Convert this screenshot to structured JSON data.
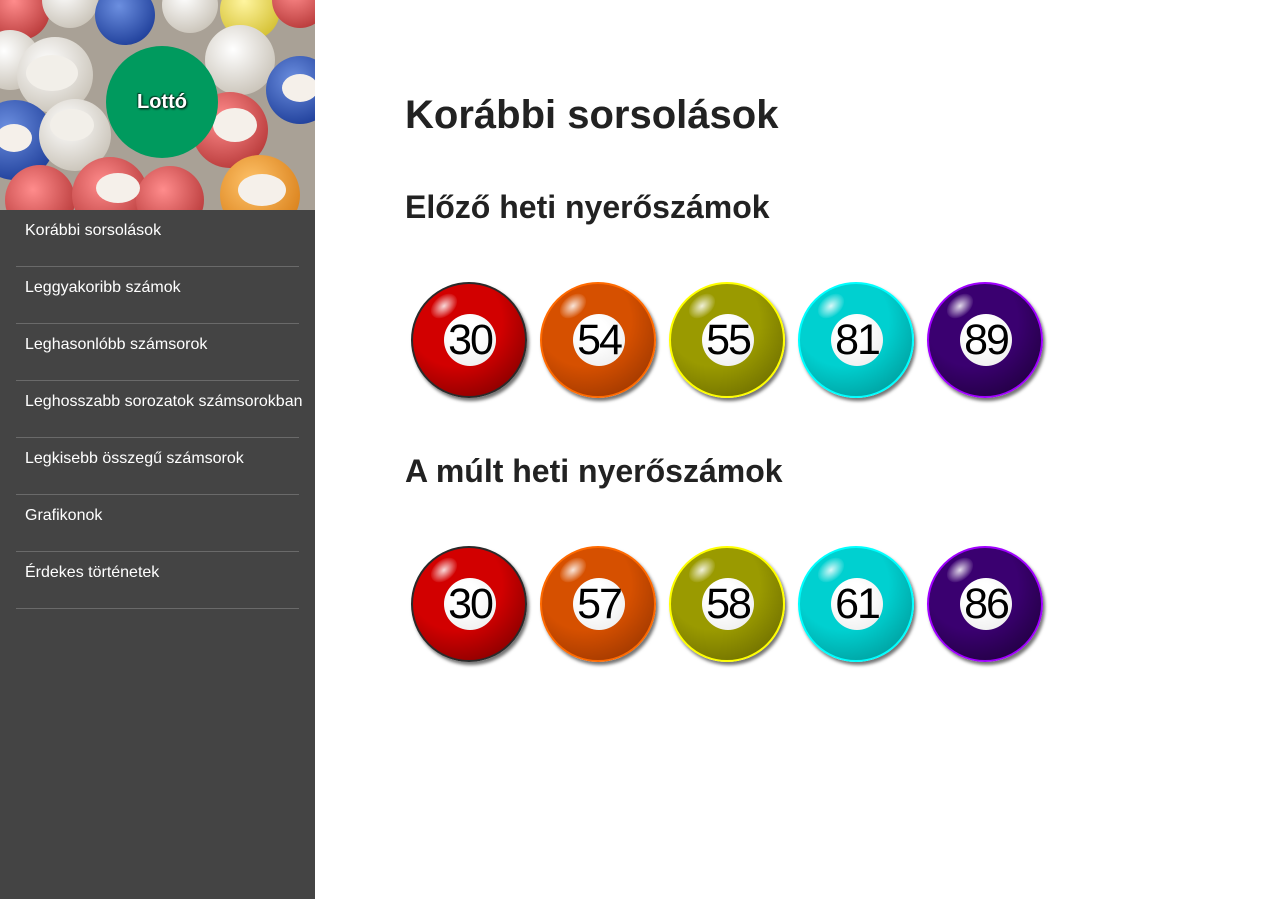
{
  "sidebar": {
    "logo_text": "Lottó",
    "logo_color": "#009a5e",
    "header_image_icon": "lottery-balls-image",
    "items": [
      {
        "label": "Korábbi sorsolások"
      },
      {
        "label": "Leggyakoribb számok"
      },
      {
        "label": "Leghasonlóbb számsorok"
      },
      {
        "label": "Leghosszabb sorozatok számsorokban"
      },
      {
        "label": "Legkisebb összegű számsorok"
      },
      {
        "label": "Grafikonok"
      },
      {
        "label": "Érdekes történetek"
      }
    ]
  },
  "main": {
    "title": "Korábbi sorsolások",
    "sections": [
      {
        "heading": "Előző heti nyerőszámok",
        "balls": [
          {
            "number": "30",
            "color": "#d20000",
            "dark": "#6a0000",
            "rim": "#2a2a2a"
          },
          {
            "number": "54",
            "color": "#d65000",
            "dark": "#8a2f00",
            "rim": "#ff6a00"
          },
          {
            "number": "55",
            "color": "#9a9a00",
            "dark": "#5f5f00",
            "rim": "#ffff00"
          },
          {
            "number": "81",
            "color": "#00d0d0",
            "dark": "#008a8a",
            "rim": "#00ffff"
          },
          {
            "number": "89",
            "color": "#3a0070",
            "dark": "#18002f",
            "rim": "#a000ff"
          }
        ]
      },
      {
        "heading": "A múlt heti nyerőszámok",
        "balls": [
          {
            "number": "30",
            "color": "#d20000",
            "dark": "#6a0000",
            "rim": "#2a2a2a"
          },
          {
            "number": "57",
            "color": "#d65000",
            "dark": "#8a2f00",
            "rim": "#ff6a00"
          },
          {
            "number": "58",
            "color": "#9a9a00",
            "dark": "#5f5f00",
            "rim": "#ffff00"
          },
          {
            "number": "61",
            "color": "#00d0d0",
            "dark": "#008a8a",
            "rim": "#00ffff"
          },
          {
            "number": "86",
            "color": "#3a0070",
            "dark": "#18002f",
            "rim": "#a000ff"
          }
        ]
      }
    ]
  }
}
